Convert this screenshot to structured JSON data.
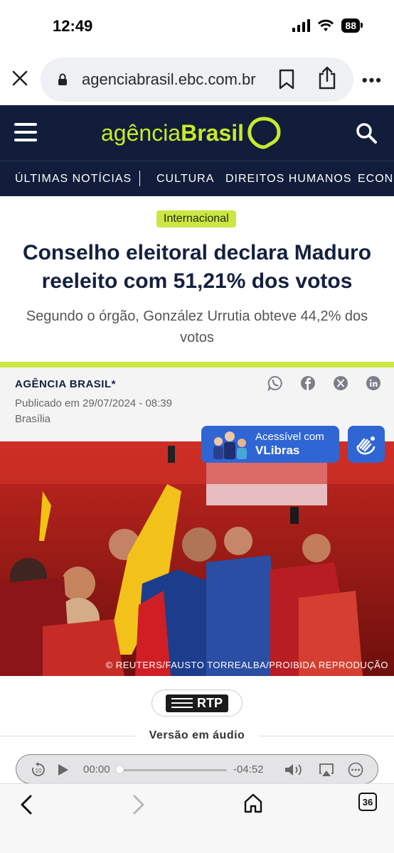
{
  "status_bar": {
    "time": "12:49",
    "battery": "88"
  },
  "browser": {
    "url": "agenciabrasil.ebc.com.br",
    "more_label": "•••",
    "tabs_count": "36"
  },
  "site": {
    "logo_light": "agência",
    "logo_bold": "Brasil",
    "nav": [
      "ÚLTIMAS NOTÍCIAS",
      "CULTURA",
      "DIREITOS HUMANOS",
      "ECONOMIA"
    ]
  },
  "article": {
    "tag": "Internacional",
    "headline": "Conselho eleitoral declara Maduro reeleito com 51,21% dos votos",
    "subhead": "Segundo o órgão, González Urrutia obteve 44,2% dos votos",
    "author": "AGÊNCIA BRASIL*",
    "published": "Publicado em 29/07/2024 - 08:39",
    "place": "Brasília",
    "photo_caption": "© REUTERS/FAUSTO TORREALBA/PROIBIDA REPRODUÇÃO"
  },
  "vlibras": {
    "line1": "Acessível com",
    "line2": "VLibras"
  },
  "audio": {
    "brand": "RTP",
    "label": "Versão em áudio",
    "current_time": "00:00",
    "remaining_time": "-04:52",
    "progress": 0
  },
  "colors": {
    "navy": "#111d3a",
    "lime": "#cde643",
    "vlibras_blue": "#2f66d4"
  }
}
